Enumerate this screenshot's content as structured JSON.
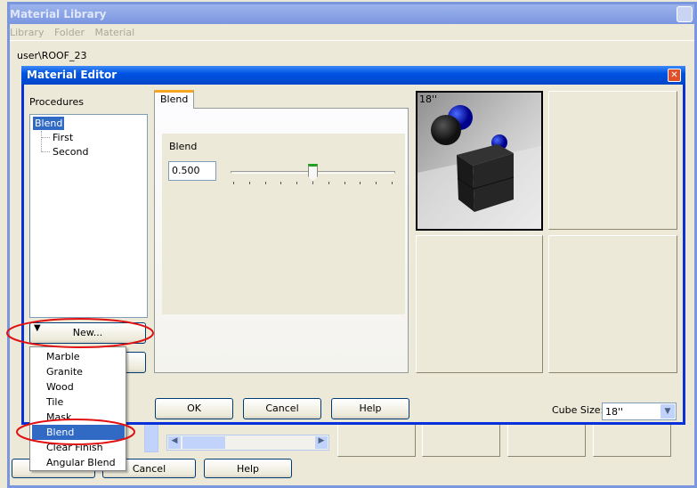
{
  "library": {
    "title": "Material Library",
    "menu": [
      "Library",
      "Folder",
      "Material"
    ],
    "path": "user\\ROOF_23",
    "buttons": [
      "Cancel",
      "Help"
    ]
  },
  "editor": {
    "title": "Material Editor",
    "procedures_label": "Procedures",
    "tree": [
      {
        "label": "Blend",
        "selected": true
      },
      {
        "label": "First"
      },
      {
        "label": "Second"
      }
    ],
    "new_button": "New...",
    "tab": "Blend",
    "group_label": "Blend",
    "blend_value": "0.500",
    "slider_fraction": 0.5,
    "preview_label": "18''",
    "ok": "OK",
    "cancel": "Cancel",
    "help": "Help",
    "cube_size_label": "Cube Size:",
    "cube_size_value": "18''"
  },
  "new_menu": {
    "items": [
      "Marble",
      "Granite",
      "Wood",
      "Tile",
      "Mask",
      "Blend",
      "Clear Finish",
      "Angular Blend"
    ],
    "selected": "Blend"
  },
  "colors": {
    "title_active": "#0054e3",
    "title_inactive": "#7a96df",
    "highlight": "#316ac5",
    "annotation": "#e01010"
  }
}
